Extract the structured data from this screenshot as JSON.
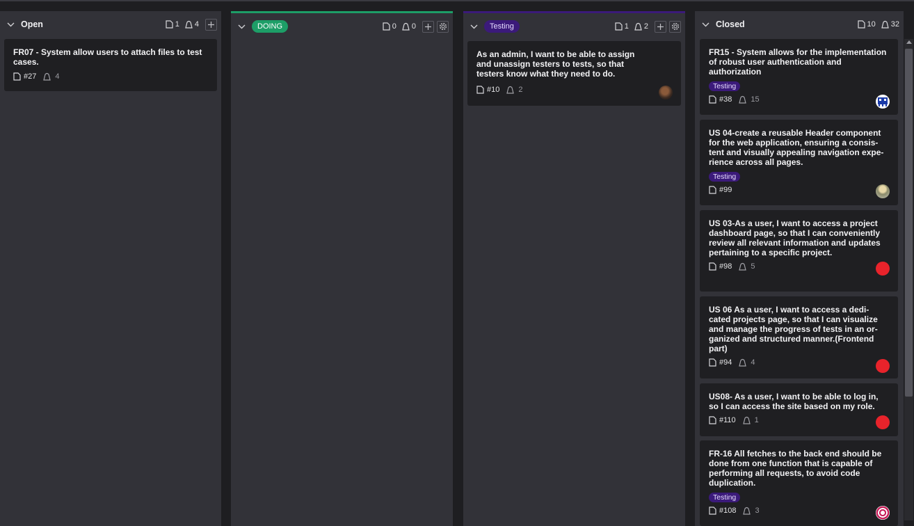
{
  "columns": {
    "open": {
      "title": "Open",
      "issues": "1",
      "points": "4"
    },
    "doing": {
      "title": "DOING",
      "issues": "0",
      "points": "0",
      "color": "#1d9e67"
    },
    "testing": {
      "title": "Testing",
      "issues": "1",
      "points": "2",
      "color": "#3b1a7a"
    },
    "closed": {
      "title": "Closed",
      "issues": "10",
      "points": "32"
    }
  },
  "cards": {
    "open": [
      {
        "title": "FR07 - System allow users to attach files to test cases.",
        "ref": "#27",
        "points": "4"
      }
    ],
    "testing": [
      {
        "title": "As an admin, I want to be able to assign and unassign testers to tests, so that testers know what they need to do.",
        "ref": "#10",
        "points": "2"
      }
    ],
    "closed": [
      {
        "title": "FR15 - System allows for the implementation of robust user authentication and authorization",
        "tag": "Testing",
        "ref": "#38",
        "points": "15"
      },
      {
        "title": "US 04-create a reusable Header component for the web application, ensuring a consis-tent and visually appealing navigation expe-rience across all pages.",
        "tag": "Testing",
        "ref": "#99"
      },
      {
        "title": "US 03-As a user, I want to access a project dashboard page, so that I can conveniently review all relevant information and updates pertaining to a specific project.",
        "ref": "#98",
        "points": "5"
      },
      {
        "title": "US 06 As a user, I want to access a dedi-cated projects page, so that I can visualize and manage the progress of tests in an or-ganized and structured manner.(Frontend part)",
        "ref": "#94",
        "points": "4"
      },
      {
        "title": "US08- As a user, I want to be able to log in, so I can access the site based on my role.",
        "ref": "#110",
        "points": "1"
      },
      {
        "title": "FR-16 All fetches to the back end should be done from one function that is capable of performing all requests, to avoid code duplication.",
        "tag": "Testing",
        "ref": "#108",
        "points": "3"
      }
    ]
  },
  "icons": {
    "collapse": "chevron-down-icon",
    "issues": "issue-icon",
    "points": "points-icon",
    "add": "plus-icon",
    "settings": "gear-icon"
  },
  "colors": {
    "avatar_red": "#e8232b"
  }
}
